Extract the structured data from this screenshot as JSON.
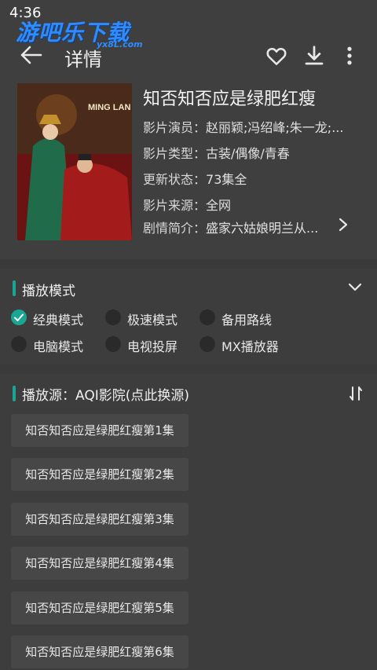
{
  "status_bar": {
    "time": "4:36"
  },
  "watermark": {
    "text": "游吧乐下载",
    "sub": "yx8L.com"
  },
  "header": {
    "title": "详情",
    "back_icon": "arrow-left-icon",
    "icons": [
      "heart-outline-icon",
      "download-icon",
      "more-vert-icon"
    ]
  },
  "movie": {
    "title": "知否知否应是绿肥红瘦",
    "meta": [
      {
        "key": "影片演员：",
        "value": "赵丽颖;冯绍峰;朱一龙;..."
      },
      {
        "key": "影片类型：",
        "value": "古装/偶像/青春"
      },
      {
        "key": "更新状态：",
        "value": "73集全"
      },
      {
        "key": "影片来源：",
        "value": "全网"
      },
      {
        "key": "剧情简介：",
        "value": "盛家六姑娘明兰从..."
      }
    ],
    "poster_text": "MING LAN"
  },
  "play_mode": {
    "title": "播放模式",
    "options": [
      {
        "label": "经典模式",
        "checked": true
      },
      {
        "label": "极速模式",
        "checked": false
      },
      {
        "label": "备用路线",
        "checked": false
      },
      {
        "label": "电脑模式",
        "checked": false
      },
      {
        "label": "电视投屏",
        "checked": false
      },
      {
        "label": "MX播放器",
        "checked": false
      }
    ]
  },
  "source": {
    "title": "播放源：AQI影院(点此换源)",
    "episodes": [
      "知否知否应是绿肥红瘦第1集",
      "知否知否应是绿肥红瘦第2集",
      "知否知否应是绿肥红瘦第3集",
      "知否知否应是绿肥红瘦第4集",
      "知否知否应是绿肥红瘦第5集",
      "知否知否应是绿肥红瘦第6集"
    ]
  },
  "colors": {
    "accent": "#1aa694",
    "background": "#3a3a3a",
    "watermark": "#2f8cff"
  }
}
